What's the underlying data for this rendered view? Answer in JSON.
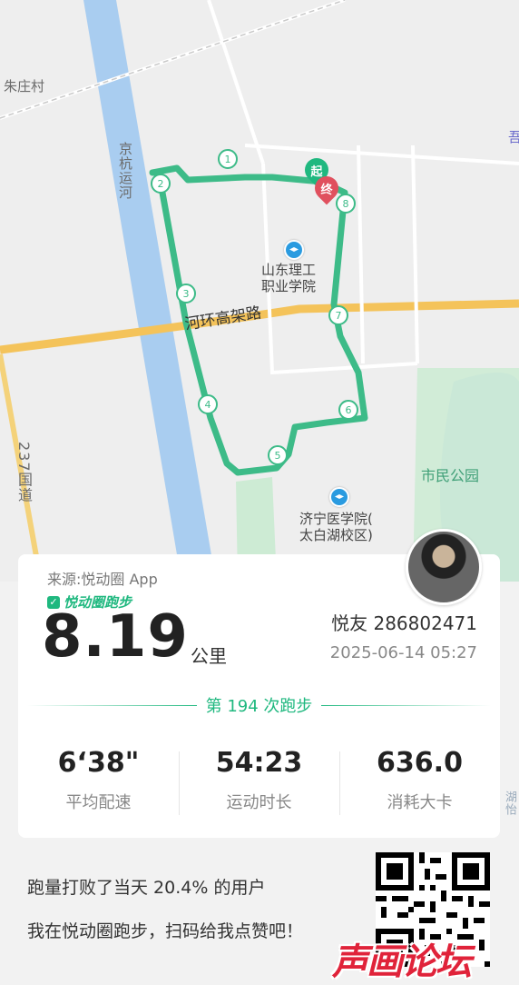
{
  "map": {
    "labels": {
      "zhuzhuang": "朱庄村",
      "canal": "京杭运河",
      "school": "山东理工\n职业学院",
      "road": "河环高架路",
      "road237": "237国道",
      "park": "市民公园",
      "medical": "济宁医学院(\n太白湖校区)",
      "edge_top": "吾",
      "edge_right": "湖怡"
    },
    "route": {
      "start_label": "起",
      "end_label": "终",
      "markers": [
        "1",
        "2",
        "3",
        "4",
        "5",
        "6",
        "7",
        "8"
      ],
      "color": "#3dbb88"
    }
  },
  "card": {
    "source": "来源:悦动圈 App",
    "brand": "悦动圈跑步",
    "distance": "8.19",
    "distance_unit": "公里",
    "user": "悦友 286802471",
    "datetime": "2025-06-14 05:27",
    "run_count": "第 194 次跑步",
    "stats": [
      {
        "value": "6‘38\"",
        "label": "平均配速"
      },
      {
        "value": "54:23",
        "label": "运动时长"
      },
      {
        "value": "636.0",
        "label": "消耗大卡"
      }
    ]
  },
  "footer": {
    "line1": "跑量打败了当天 20.4% 的用户",
    "line2": "我在悦动圈跑步，扫码给我点赞吧！",
    "watermark": "声画论坛"
  },
  "colors": {
    "accent": "#1fb87f",
    "end_pin": "#e0505e"
  }
}
